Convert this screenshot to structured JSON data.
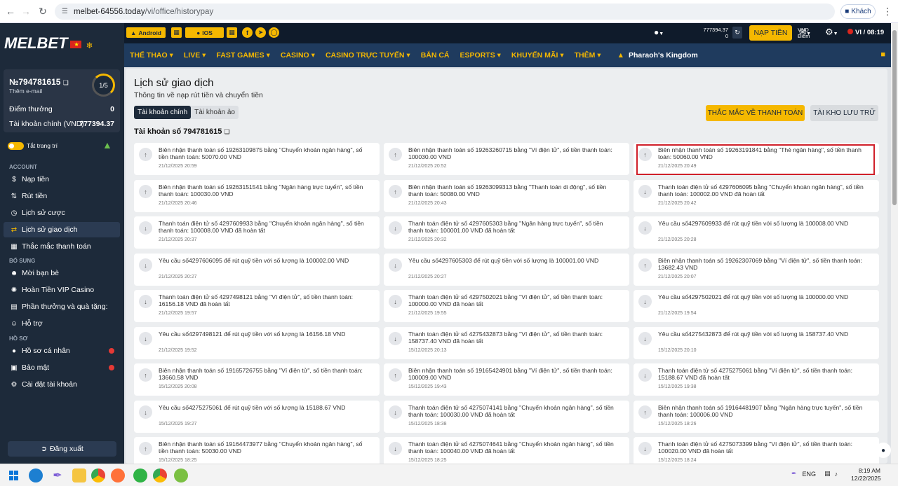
{
  "browser": {
    "url_host": "melbet-64556.today",
    "url_path": "/vi/office/historypay",
    "guest_label": "Khách"
  },
  "header": {
    "logo": "MELBET",
    "android_label": "Android",
    "ios_label": "IOS",
    "currency": "VND",
    "points_label": "Điểm",
    "balance": "777394.37",
    "points": "0",
    "deposit_label": "NẠP TIỀN",
    "lang_time": "VI / 08:19",
    "nav": [
      "THỂ THAO",
      "LIVE",
      "FAST GAMES",
      "CASINO",
      "CASINO TRỰC TUYẾN",
      "BẮN CÁ",
      "ESPORTS",
      "KHUYẾN MÃI",
      "THÊM",
      "Pharaoh's Kingdom"
    ]
  },
  "sidebar": {
    "account_no": "№794781615",
    "add_email": "Thêm e-mail",
    "level": "1/5",
    "bonus_points_label": "Điểm thưởng",
    "bonus_points_value": "0",
    "main_account_label": "Tài khoản chính (VND)",
    "main_account_value": "777394.37",
    "toggle_label": "Tắt trang trí",
    "section_account": "ACCOUNT",
    "section_extra": "BỔ SUNG",
    "section_profile": "HỒ SƠ",
    "items": [
      "Nạp tiền",
      "Rút tiền",
      "Lịch sử cược",
      "Lịch sử giao dịch",
      "Thắc mắc thanh toán",
      "Mời bạn bè",
      "Hoàn Tiền VIP Casino",
      "Phần thưởng và quà tặng:",
      "Hỗ trợ",
      "Hồ sơ cá nhân",
      "Bảo mật",
      "Cài đặt tài khoản"
    ],
    "logout": "Đăng xuất"
  },
  "main": {
    "title": "Lịch sử giao dịch",
    "subtitle": "Thông tin về nạp rút tiền và chuyển tiền",
    "tab_main": "Tài khoản chính",
    "tab_virtual": "Tài khoản ảo",
    "faq_button": "THẮC MẮC VỀ THANH TOÁN",
    "archive_button": "TÀI KHO LƯU TRỮ",
    "account_title": "Tài khoản số 794781615",
    "transactions": [
      {
        "dir": "up",
        "text": "Biên nhận thanh toán số 19263109875 bằng \"Chuyển khoản ngân hàng\", số tiền thanh toán: 50070.00 VND",
        "date": "21/12/2025 20:59"
      },
      {
        "dir": "up",
        "text": "Biên nhận thanh toán số 19263260715 bằng \"Ví điện tử\", số tiền thanh toán: 100030.00 VND",
        "date": "21/12/2025 20:52"
      },
      {
        "dir": "up",
        "text": "Biên nhận thanh toán số 19263191841 bằng \"Thẻ ngân hàng\", số tiền thanh toán: 50060.00 VND",
        "date": "21/12/2025 20:49"
      },
      {
        "dir": "up",
        "text": "Biên nhận thanh toán số 19263151541 bằng \"Ngân hàng trực tuyến\", số tiền thanh toán: 100030.00 VND",
        "date": "21/12/2025 20:46"
      },
      {
        "dir": "up",
        "text": "Biên nhận thanh toán số 19263099313 bằng \"Thanh toán di động\", số tiền thanh toán: 50080.00 VND",
        "date": "21/12/2025 20:43"
      },
      {
        "dir": "down",
        "text": "Thanh toán điện tử số 4297606095 bằng \"Chuyển khoản ngân hàng\", số tiền thanh toán: 100002.00 VND đã hoàn tất",
        "date": "21/12/2025 20:42"
      },
      {
        "dir": "down",
        "text": "Thanh toán điện tử số 4297609933 bằng \"Chuyển khoản ngân hàng\", số tiền thanh toán: 100008.00 VND đã hoàn tất",
        "date": "21/12/2025 20:37"
      },
      {
        "dir": "down",
        "text": "Thanh toán điện tử số 4297605303 bằng \"Ngân hàng trực tuyến\", số tiền thanh toán: 100001.00 VND đã hoàn tất",
        "date": "21/12/2025 20:32"
      },
      {
        "dir": "down",
        "text": "Yêu cầu số4297609933 để rút quỹ tiền với số lượng là 100008.00 VND",
        "date": "21/12/2025 20:28"
      },
      {
        "dir": "down",
        "text": "Yêu cầu số4297606095 để rút quỹ tiền với số lượng là 100002.00 VND",
        "date": "21/12/2025 20:27"
      },
      {
        "dir": "down",
        "text": "Yêu cầu số4297605303 để rút quỹ tiền với số lượng là 100001.00 VND",
        "date": "21/12/2025 20:27"
      },
      {
        "dir": "up",
        "text": "Biên nhận thanh toán số 19262307069 bằng \"Ví điện tử\", số tiền thanh toán: 13682.43 VND",
        "date": "21/12/2025 20:07"
      },
      {
        "dir": "down",
        "text": "Thanh toán điện tử số 4297498121 bằng \"Ví điện tử\", số tiền thanh toán: 16156.18 VND đã hoàn tất",
        "date": "21/12/2025 19:57"
      },
      {
        "dir": "down",
        "text": "Thanh toán điện tử số 4297502021 bằng \"Ví điện tử\", số tiền thanh toán: 100000.00 VND đã hoàn tất",
        "date": "21/12/2025 19:55"
      },
      {
        "dir": "down",
        "text": "Yêu cầu số4297502021 để rút quỹ tiền với số lượng là 100000.00 VND",
        "date": "21/12/2025 19:54"
      },
      {
        "dir": "down",
        "text": "Yêu cầu số4297498121 để rút quỹ tiền với số lượng là 16156.18 VND",
        "date": "21/12/2025 19:52"
      },
      {
        "dir": "down",
        "text": "Thanh toán điện tử số 4275432873 bằng \"Ví điện tử\", số tiền thanh toán: 158737.40 VND đã hoàn tất",
        "date": "15/12/2025 20:13"
      },
      {
        "dir": "down",
        "text": "Yêu cầu số4275432873 để rút quỹ tiền với số lượng là 158737.40 VND",
        "date": "15/12/2025 20:10"
      },
      {
        "dir": "up",
        "text": "Biên nhận thanh toán số 19165726755 bằng \"Ví điện tử\", số tiền thanh toán: 13660.58 VND",
        "date": "15/12/2025 20:08"
      },
      {
        "dir": "up",
        "text": "Biên nhận thanh toán số 19165424901 bằng \"Ví điện tử\", số tiền thanh toán: 100009.00 VND",
        "date": "15/12/2025 19:43"
      },
      {
        "dir": "down",
        "text": "Thanh toán điện tử số 4275275061 bằng \"Ví điện tử\", số tiền thanh toán: 15188.67 VND đã hoàn tất",
        "date": "15/12/2025 19:38"
      },
      {
        "dir": "down",
        "text": "Yêu cầu số4275275061 để rút quỹ tiền với số lượng là 15188.67 VND",
        "date": "15/12/2025 19:27"
      },
      {
        "dir": "down",
        "text": "Thanh toán điện tử số 4275074141 bằng \"Chuyển khoản ngân hàng\", số tiền thanh toán: 100030.00 VND đã hoàn tất",
        "date": "15/12/2025 18:38"
      },
      {
        "dir": "up",
        "text": "Biên nhận thanh toán số 19164481907 bằng \"Ngân hàng trực tuyến\", số tiền thanh toán: 100006.00 VND",
        "date": "15/12/2025 18:26"
      },
      {
        "dir": "up",
        "text": "Biên nhận thanh toán số 19164473977 bằng \"Chuyển khoản ngân hàng\", số tiền thanh toán: 50030.00 VND",
        "date": "15/12/2025 18:25"
      },
      {
        "dir": "down",
        "text": "Thanh toán điện tử số 4275074641 bằng \"Chuyển khoản ngân hàng\", số tiền thanh toán: 100040.00 VND đã hoàn tất",
        "date": "15/12/2025 18:25"
      },
      {
        "dir": "down",
        "text": "Thanh toán điện tử số 4275073399 bằng \"Ví điện tử\", số tiền thanh toán: 100020.00 VND đã hoàn tất",
        "date": "15/12/2025 18:24"
      }
    ]
  },
  "taskbar": {
    "lang": "ENG",
    "time": "8:19 AM",
    "date": "12/22/2025"
  },
  "colors": {
    "accent": "#f5b800",
    "header_bg": "#1d2a3a",
    "nav_bg": "#1f3b5e",
    "highlight": "#d0202a"
  }
}
